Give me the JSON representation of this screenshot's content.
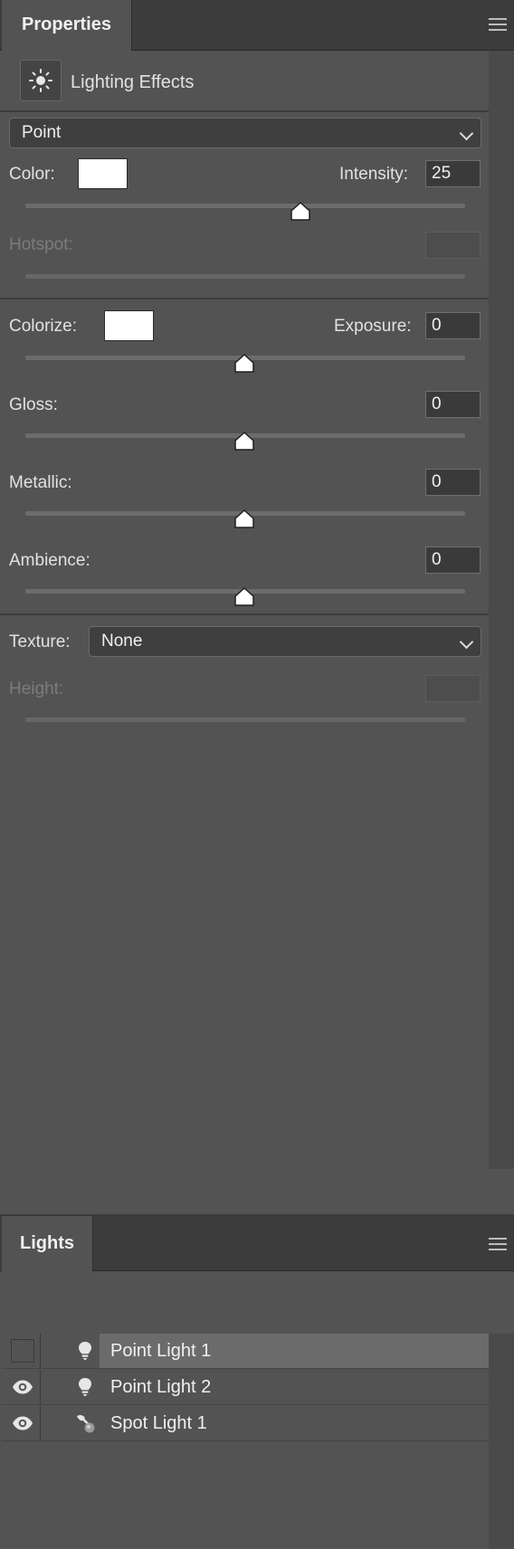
{
  "properties_panel": {
    "tab_label": "Properties",
    "adjustment_title": "Lighting Effects",
    "light_type": "Point",
    "color_label": "Color:",
    "color_value": "#ffffff",
    "intensity_label": "Intensity:",
    "intensity_value": "25",
    "hotspot_label": "Hotspot:",
    "hotspot_value": "",
    "colorize_label": "Colorize:",
    "colorize_value": "#ffffff",
    "exposure_label": "Exposure:",
    "exposure_value": "0",
    "gloss_label": "Gloss:",
    "gloss_value": "0",
    "metallic_label": "Metallic:",
    "metallic_value": "0",
    "ambience_label": "Ambience:",
    "ambience_value": "0",
    "texture_label": "Texture:",
    "texture_value": "None",
    "height_label": "Height:",
    "height_value": ""
  },
  "lights_panel": {
    "tab_label": "Lights",
    "items": [
      {
        "label": "Point Light 1",
        "icon": "point-light-icon",
        "visible": false,
        "selected": true
      },
      {
        "label": "Point Light 2",
        "icon": "point-light-icon",
        "visible": true,
        "selected": false
      },
      {
        "label": "Spot Light 1",
        "icon": "spot-light-icon",
        "visible": true,
        "selected": false
      }
    ]
  }
}
